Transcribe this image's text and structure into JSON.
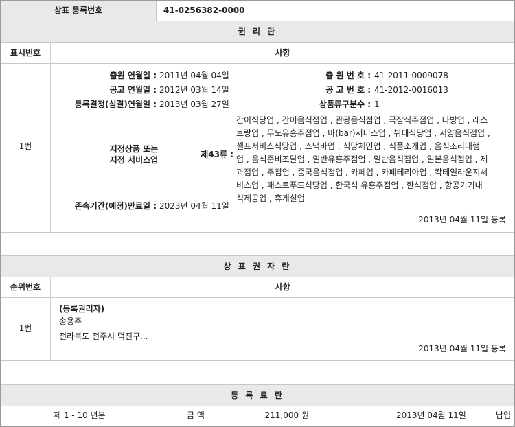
{
  "reg_number": {
    "label": "상표 등록번호",
    "value": "41-0256382-0000"
  },
  "rights": {
    "section_title": "권 리 란",
    "col_no": "표시번호",
    "col_matter": "사항",
    "row_no": "1번",
    "app_date_label": "출원 연월일 :",
    "app_date": "2011년 04월 04일",
    "app_no_label": "출 원 번 호 :",
    "app_no": "41-2011-0009078",
    "pub_date_label": "공고 연월일 :",
    "pub_date": "2012년 03월 14일",
    "pub_no_label": "공 고 번 호 :",
    "pub_no": "41-2012-0016013",
    "decision_label": "등록결정(심결)연월일 :",
    "decision_date": "2013년 03월 27일",
    "class_count_label": "상품류구분수 :",
    "class_count": "1",
    "goods_label_1": "지정상품 또는",
    "goods_label_2": "지정 서비스업",
    "class_label": "제43류 :",
    "goods_lines": [
      "간이식당업 , 간이음식점업 , 관광음식점업 , 극장식주점업 , 다방업 , 레스",
      "토랑업 , 무도유흥주점업 , 바(bar)서비스업 , 뷔페식당업 , 서양음식점업 ,",
      "셀프서비스식당업 , 스낵바업 , 식당체인업 , 식품소개업 , 음식조리대행",
      "업 , 음식준비조달업 , 일반유흥주점업 , 일반음식점업 , 일본음식점업 , 제",
      "과점업 , 주점업 , 중국음식점업 , 카페업 , 카페테리아업 , 칵테일라운지서",
      "비스업 , 패스트푸드식당업 , 한국식 유흥주점업 , 한식점업 , 항공기기내",
      "식제공업 , 휴게실업"
    ],
    "expiry_label": "존속기간(예정)만료일 :",
    "expiry_date": "2023년 04월 11일",
    "reg_note": "2013년 04월 11일 등록"
  },
  "holders": {
    "section_title": "상 표 권 자 란",
    "col_no": "순위번호",
    "col_matter": "사항",
    "row_no": "1번",
    "role": "(등록권리자)",
    "name": "송용주",
    "address": "전라북도 전주시 덕진구...",
    "reg_note": "2013년 04월 11일 등록"
  },
  "fees": {
    "section_title": "등 록 료 란",
    "period": "제 1 - 10 년분",
    "amount_label": "금 액",
    "amount": "211,000 원",
    "date": "2013년 04월 11일",
    "status": "납입"
  }
}
